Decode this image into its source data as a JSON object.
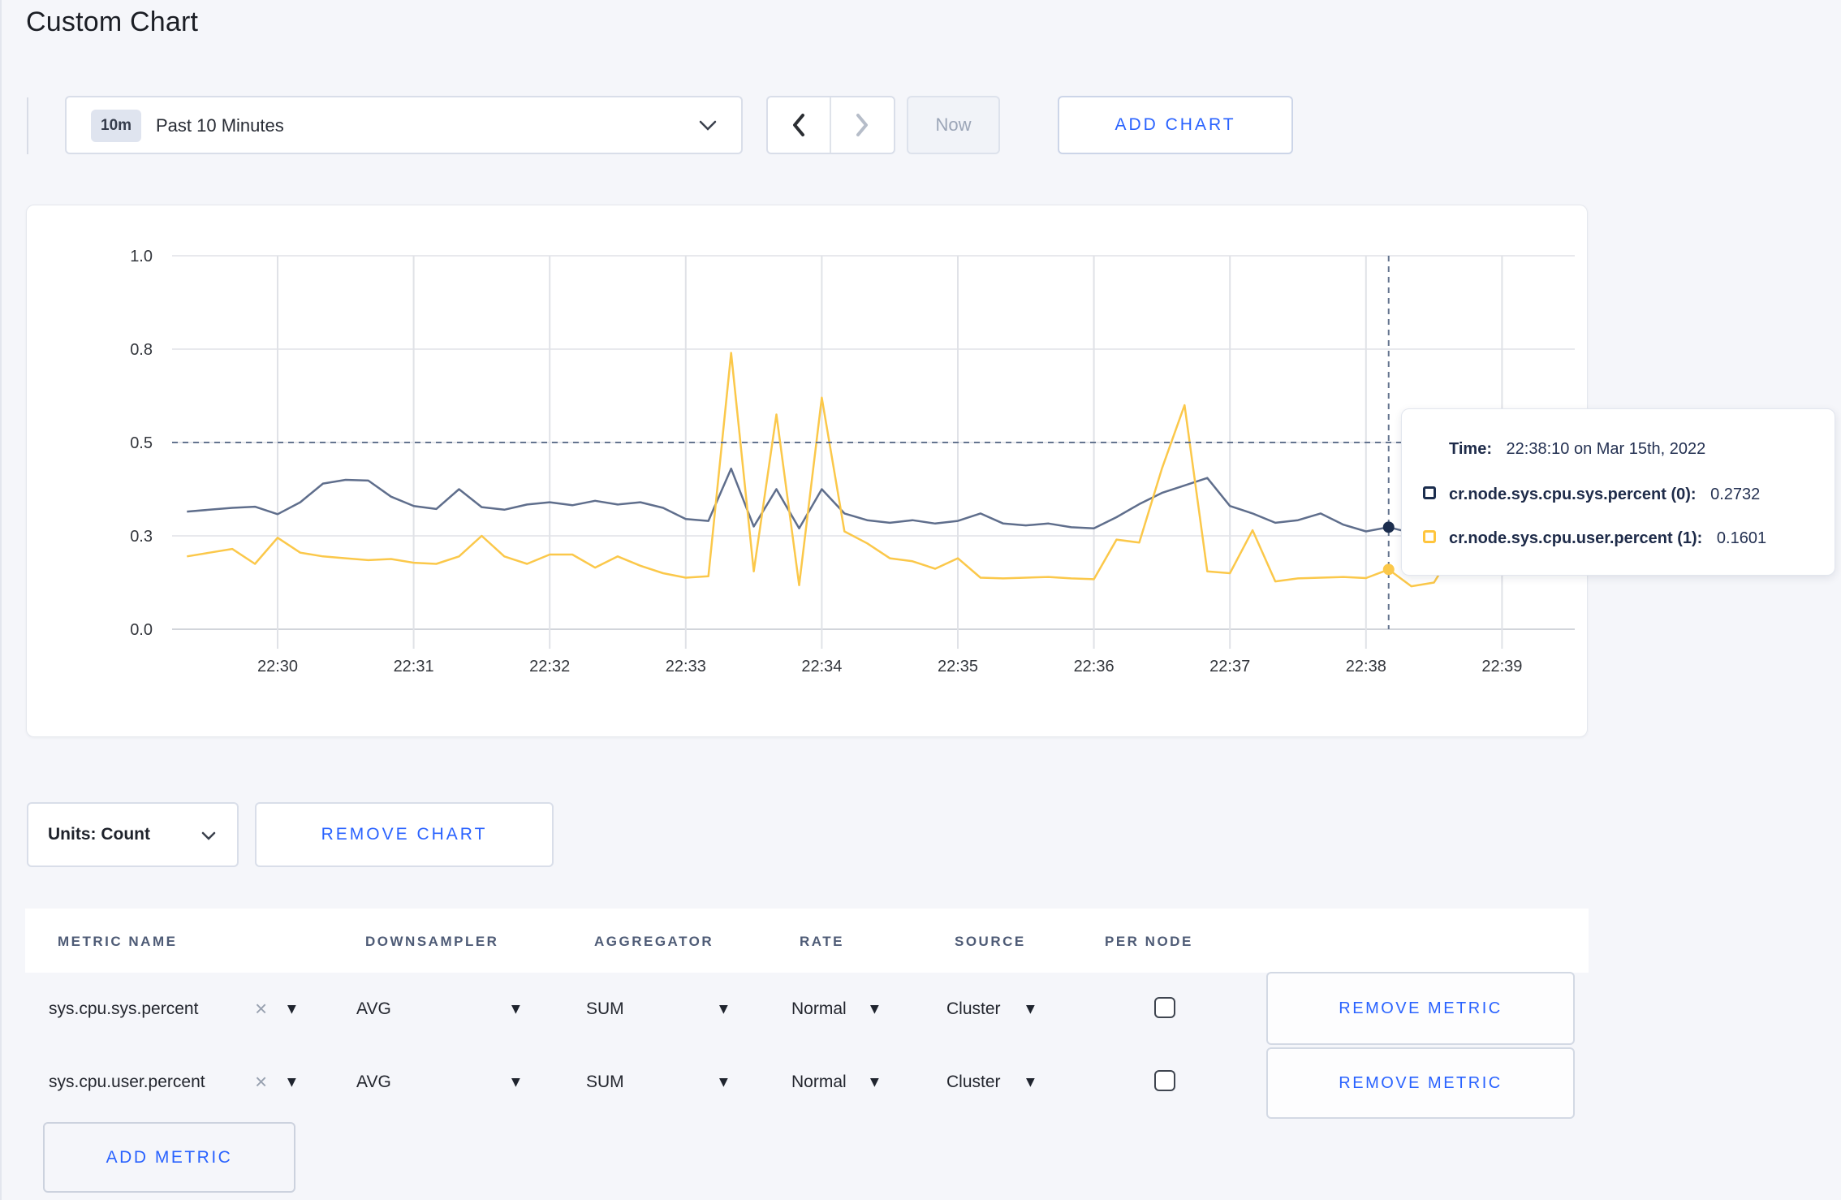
{
  "page": {
    "title": "Custom Chart"
  },
  "colors": {
    "accent_blue": "#2962ff",
    "series_sys_line": "#5f6e8c",
    "series_sys_swatch": "#1b2d4e",
    "series_user_line": "#fbc84a",
    "series_user_swatch": "#ffc53d",
    "grid": "#e8e9ed",
    "axis_text": "#33363c",
    "crosshair": "#64748f"
  },
  "toolbar": {
    "time_range": {
      "badge": "10m",
      "label": "Past 10 Minutes"
    },
    "now_label": "Now",
    "add_chart_label": "ADD CHART"
  },
  "chart_data": {
    "type": "line",
    "ylim": [
      0,
      1
    ],
    "y_tick_values": [
      0,
      0.25,
      0.5,
      0.75,
      1.0
    ],
    "y_tick_labels": [
      "0.0",
      "0.3",
      "0.5",
      "0.8",
      "1.0"
    ],
    "x_ticks": [
      "22:30",
      "22:31",
      "22:32",
      "22:33",
      "22:34",
      "22:35",
      "22:36",
      "22:37",
      "22:38",
      "22:39"
    ],
    "x_start": "22:29:20",
    "x_step_seconds": 10,
    "grid": true,
    "series": [
      {
        "name": "cr.node.sys.cpu.sys.percent",
        "values": [
          0.315,
          0.32,
          0.325,
          0.328,
          0.308,
          0.34,
          0.39,
          0.4,
          0.398,
          0.355,
          0.33,
          0.322,
          0.375,
          0.327,
          0.32,
          0.334,
          0.34,
          0.332,
          0.344,
          0.334,
          0.34,
          0.325,
          0.295,
          0.29,
          0.43,
          0.275,
          0.375,
          0.27,
          0.375,
          0.31,
          0.292,
          0.285,
          0.292,
          0.283,
          0.29,
          0.31,
          0.283,
          0.278,
          0.283,
          0.273,
          0.27,
          0.3,
          0.335,
          0.365,
          0.385,
          0.405,
          0.33,
          0.31,
          0.285,
          0.292,
          0.31,
          0.28,
          0.262,
          0.2732,
          0.258,
          0.262,
          0.272,
          0.265,
          0.27
        ]
      },
      {
        "name": "cr.node.sys.cpu.user.percent",
        "values": [
          0.195,
          0.205,
          0.215,
          0.175,
          0.245,
          0.205,
          0.195,
          0.19,
          0.185,
          0.188,
          0.178,
          0.175,
          0.195,
          0.25,
          0.195,
          0.175,
          0.2,
          0.2,
          0.165,
          0.195,
          0.17,
          0.15,
          0.138,
          0.142,
          0.74,
          0.155,
          0.575,
          0.118,
          0.62,
          0.262,
          0.23,
          0.19,
          0.182,
          0.162,
          0.19,
          0.138,
          0.136,
          0.138,
          0.14,
          0.136,
          0.134,
          0.24,
          0.232,
          0.43,
          0.6,
          0.155,
          0.15,
          0.265,
          0.128,
          0.136,
          0.138,
          0.14,
          0.137,
          0.1601,
          0.115,
          0.125,
          0.225,
          0.245,
          0.2
        ]
      }
    ],
    "crosshair": {
      "time": "22:38:10",
      "minutes_from_first_tick": 8.1667,
      "horizontal_value": 0.5,
      "point_values": [
        0.2732,
        0.1601
      ]
    }
  },
  "tooltip": {
    "time_label": "Time:",
    "time_value": "22:38:10 on Mar 15th, 2022",
    "rows": [
      {
        "label": "cr.node.sys.cpu.sys.percent (0):",
        "value": "0.2732"
      },
      {
        "label": "cr.node.sys.cpu.user.percent (1):",
        "value": "0.1601"
      }
    ]
  },
  "chart_controls": {
    "units_label": "Units: Count",
    "remove_chart_label": "REMOVE CHART"
  },
  "table": {
    "headers": [
      "METRIC NAME",
      "DOWNSAMPLER",
      "AGGREGATOR",
      "RATE",
      "SOURCE",
      "PER NODE"
    ],
    "rows": [
      {
        "metric": "sys.cpu.sys.percent",
        "downsampler": "AVG",
        "aggregator": "SUM",
        "rate": "Normal",
        "source": "Cluster",
        "per_node_checked": false,
        "remove_label": "REMOVE METRIC"
      },
      {
        "metric": "sys.cpu.user.percent",
        "downsampler": "AVG",
        "aggregator": "SUM",
        "rate": "Normal",
        "source": "Cluster",
        "per_node_checked": false,
        "remove_label": "REMOVE METRIC"
      }
    ],
    "add_metric_label": "ADD METRIC"
  }
}
